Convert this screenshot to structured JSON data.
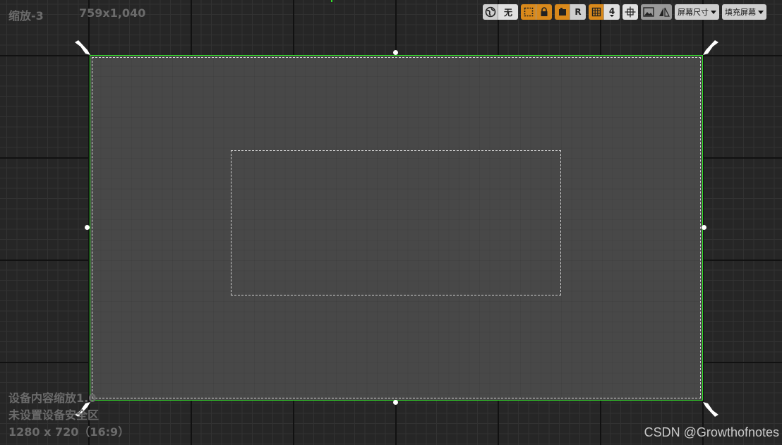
{
  "hud": {
    "zoom": "缩放-3",
    "size": "759x1,040",
    "dpi_scale": "设备内容缩放1.0",
    "safe_zone": "未设置设备安全区",
    "resolution": "1280 x 720（16:9）"
  },
  "toolbar": {
    "globe_icon": "globe-icon",
    "none_label": "无",
    "r_label": "R",
    "snap_value": "4",
    "screen_size_label": "屏幕尺寸",
    "fill_screen_label": "填充屏幕"
  },
  "watermark": "CSDN @Growthofnotes",
  "colors": {
    "accent_orange": "#d9891b",
    "canvas_border": "#34e52a",
    "canvas_fill": "#484848"
  }
}
